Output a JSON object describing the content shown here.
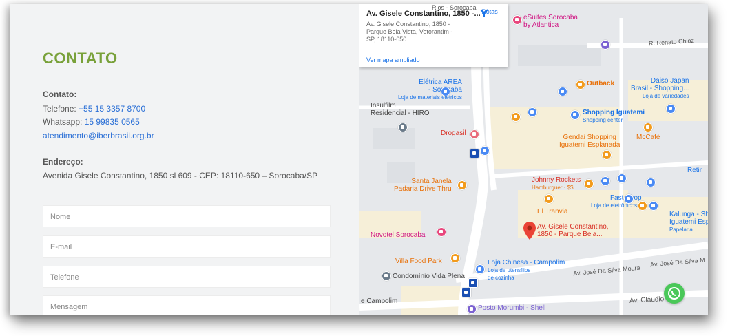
{
  "contact": {
    "title": "CONTATO",
    "contact_label": "Contato:",
    "phone_prefix": "Telefone: ",
    "phone": "+55 15 3357 8700",
    "whatsapp_prefix": "Whatsapp: ",
    "whatsapp": "15 99835 0565",
    "email": "atendimento@iberbrasil.org.br",
    "address_label": "Endereço:",
    "address": "Avenida Gisele Constantino, 1850 sl 609 - CEP: 18110-650 – Sorocaba/SP"
  },
  "form": {
    "name_placeholder": "Nome",
    "email_placeholder": "E-mail",
    "phone_placeholder": "Telefone",
    "message_placeholder": "Mensagem"
  },
  "map": {
    "card_title": "Av. Gisele Constantino, 1850 -...",
    "card_address": "Av. Gisele Constantino, 1850 - Parque Bela Vista, Votorantim - SP, 18110-650",
    "card_link": "Ver mapa ampliado",
    "route_label": "Rotas",
    "marker_label_1": "Av. Gisele Constantino,",
    "marker_label_2": "1850 - Parque Bela...",
    "pois": {
      "esuites_1": "eSuites Sorocaba",
      "esuites_2": "by Atlantica",
      "eletrica_1": "Elétrica AREA",
      "eletrica_2": "- Sorocaba",
      "eletrica_3": "Loja de materiais elétricos",
      "insulfilm_1": "Insulfilm",
      "insulfilm_2": "Residencial - HIRO",
      "drogasil": "Drogasil",
      "outback": "Outback",
      "daiso_1": "Daiso Japan",
      "daiso_2": "Brasil - Shopping...",
      "daiso_3": "Loja de variedades",
      "iguatemi_1": "Shopping Iguatemi",
      "iguatemi_2": "Shopping center",
      "gendai_1": "Gendai Shopping",
      "gendai_2": "Iguatemi Esplanada",
      "mccafe": "McCafé",
      "santa_1": "Santa Janela",
      "santa_2": "Padaria Drive Thru",
      "johnny_1": "Johnny Rockets",
      "johnny_2": "Hamburguer · $$",
      "fastshop_1": "Fast Shop",
      "fastshop_2": "Loja de eletrônicos",
      "tranvia": "El Tranvia",
      "kalunga_1": "Kalunga - Sho",
      "kalunga_2": "Iguatemi Espl",
      "kalunga_3": "Papelaria",
      "novotel": "Novotel Sorocaba",
      "villa": "Villa Food Park",
      "chinesa_1": "Loja Chinesa - Campolim",
      "chinesa_2": "Loja de utensílios",
      "chinesa_3": "de cozinha",
      "condominio": "Condomínio Vida Plena",
      "campolim": "e Campolim",
      "posto": "Posto Morumbi - Shell",
      "retir": "Retir"
    },
    "roads": {
      "renato": "R. Renato Chioz",
      "jose1": "Av. José Da Silva Moura",
      "jose2": "Av. José Da Silva M",
      "claudio": "Av. Cláudio Pin",
      "top": "Rios - Sorocaba"
    }
  },
  "colors": {
    "accent": "#79a13a",
    "link": "#2a6fd6",
    "map_bg": "#e6e8eb",
    "whatsapp": "#4ac859"
  }
}
